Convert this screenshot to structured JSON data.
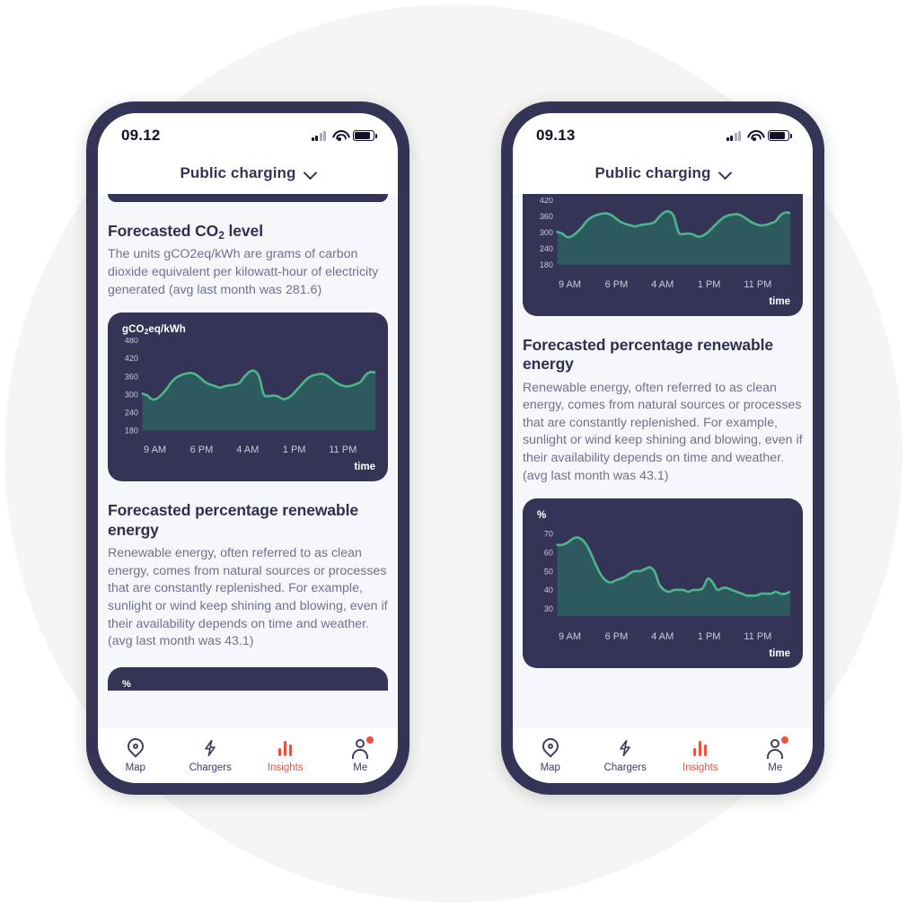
{
  "left_phone": {
    "status": {
      "clock": "09.12",
      "signal_icon": "signal-bars-icon",
      "wifi_icon": "wifi-icon",
      "battery_icon": "battery-icon"
    },
    "header": {
      "title": "Public charging",
      "chevron_icon": "chevron-down-icon"
    },
    "sections": [
      {
        "title_prefix": "Forecasted CO",
        "title_sub": "2",
        "title_suffix": " level",
        "body": "The units gCO2eq/kWh are grams of carbon dioxide equivalent per kilowatt-hour of electricity generated (avg last month was 281.6)"
      },
      {
        "title": "Forecasted percentage renewable energy",
        "body": "Renewable energy, often referred to as clean energy, comes from natural sources or processes that are constantly replenished. For example, sunlight or wind keep shining and blowing, even if their availability depends on time and weather. (avg last month was 43.1)"
      }
    ],
    "peek_card_unit": "%"
  },
  "right_phone": {
    "status": {
      "clock": "09.13",
      "signal_icon": "signal-bars-icon",
      "wifi_icon": "wifi-icon",
      "battery_icon": "battery-icon"
    },
    "header": {
      "title": "Public charging",
      "chevron_icon": "chevron-down-icon"
    },
    "section": {
      "title": "Forecasted percentage renewable energy",
      "body": "Renewable energy, often referred to as clean energy, comes from natural sources or processes that are constantly replenished. For example, sunlight or wind keep shining and blowing, even if their availability depends on time and weather. (avg last month was 43.1)"
    }
  },
  "tabbar": {
    "items": [
      {
        "label": "Map",
        "icon": "map-pin-icon",
        "active": false,
        "badge": false
      },
      {
        "label": "Chargers",
        "icon": "lightning-bolt-icon",
        "active": false,
        "badge": false
      },
      {
        "label": "Insights",
        "icon": "bar-chart-icon",
        "active": true,
        "badge": false
      },
      {
        "label": "Me",
        "icon": "person-icon",
        "active": false,
        "badge": true
      }
    ]
  },
  "colors": {
    "frame": "#343556",
    "card": "#343556",
    "area_fill": "#2d5a5e",
    "line": "#4bb68a",
    "accent": "#f0513f",
    "page_bg": "#f6f7fb",
    "circle_bg": "#f6f5f3",
    "heading": "#2e3050",
    "body_text": "#6e7290"
  },
  "chart_data": [
    {
      "id": "co2_left",
      "type": "area",
      "title": "Forecasted CO2 level",
      "unit_label": "gCO₂eq/kWh",
      "ylabel": "gCO2eq/kWh",
      "xlabel": "time",
      "ylim": [
        180,
        480
      ],
      "yticks": [
        480,
        420,
        360,
        300,
        240,
        180
      ],
      "xticks": [
        "9 AM",
        "6 PM",
        "4 AM",
        "1 PM",
        "11 PM"
      ],
      "grid": false,
      "values": [
        302,
        296,
        283,
        286,
        300,
        318,
        341,
        356,
        364,
        369,
        371,
        366,
        353,
        340,
        332,
        327,
        322,
        327,
        330,
        332,
        338,
        358,
        374,
        378,
        360,
        300,
        294,
        296,
        292,
        284,
        288,
        300,
        318,
        336,
        352,
        362,
        366,
        368,
        362,
        350,
        338,
        330,
        326,
        328,
        334,
        342,
        364,
        374,
        372
      ]
    },
    {
      "id": "co2_right",
      "type": "area",
      "title": "Forecasted CO2 level",
      "unit_label": "gCO₂eq/kWh",
      "ylabel": "gCO2eq/kWh",
      "xlabel": "time",
      "ylim": [
        180,
        420
      ],
      "yticks": [
        420,
        360,
        300,
        240,
        180
      ],
      "xticks": [
        "9 AM",
        "6 PM",
        "4 AM",
        "1 PM",
        "11 PM"
      ],
      "grid": false,
      "values": [
        302,
        296,
        283,
        286,
        300,
        318,
        341,
        356,
        364,
        369,
        371,
        366,
        353,
        340,
        332,
        327,
        322,
        327,
        330,
        332,
        338,
        358,
        374,
        378,
        360,
        300,
        294,
        296,
        292,
        284,
        288,
        300,
        318,
        336,
        352,
        362,
        366,
        368,
        362,
        350,
        338,
        330,
        326,
        328,
        334,
        342,
        364,
        374,
        372
      ]
    },
    {
      "id": "renewable_right",
      "type": "area",
      "title": "Forecasted percentage renewable energy",
      "unit_label": "%",
      "ylabel": "%",
      "xlabel": "time",
      "ylim": [
        26,
        74
      ],
      "yticks": [
        70,
        60,
        50,
        40,
        30
      ],
      "xticks": [
        "9 AM",
        "6 PM",
        "4 AM",
        "1 PM",
        "11 PM"
      ],
      "grid": false,
      "values": [
        64,
        64,
        65,
        67,
        68,
        67,
        64,
        59,
        53,
        48,
        45,
        44,
        45,
        46,
        47,
        49,
        50,
        50,
        51,
        52,
        50,
        43,
        40,
        39,
        40,
        40,
        40,
        39,
        40,
        40,
        41,
        46,
        44,
        40,
        41,
        41,
        40,
        39,
        38,
        37,
        37,
        37,
        38,
        38,
        38,
        39,
        38,
        38,
        39
      ]
    }
  ]
}
